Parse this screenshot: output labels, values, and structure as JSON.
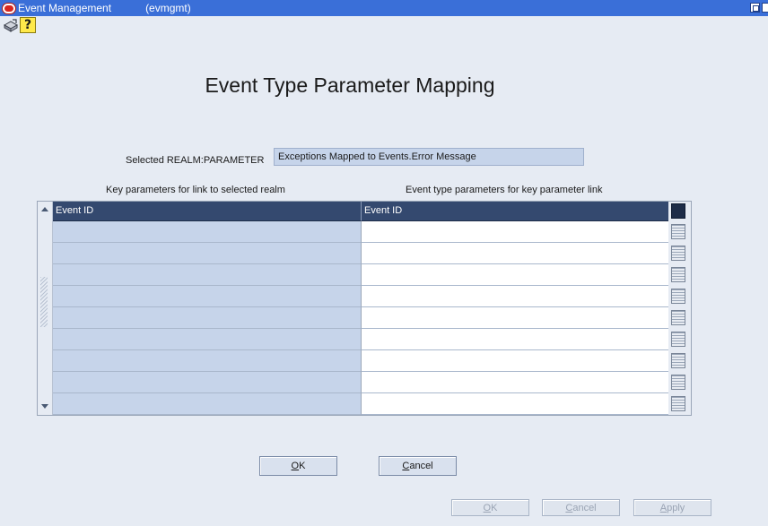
{
  "window": {
    "app_title": "Event Management",
    "module": "(evmgmt)"
  },
  "toolbar": {
    "action_icon": "action-icon",
    "help_label": "?"
  },
  "page": {
    "heading": "Event Type Parameter Mapping",
    "selected_label": "Selected REALM:PARAMETER",
    "selected_value": "Exceptions Mapped to Events.Error Message"
  },
  "table": {
    "left_caption": "Key parameters for link to selected realm",
    "right_caption": "Event type parameters for key parameter link",
    "columns": [
      "Event ID",
      "Event ID"
    ],
    "rows": [
      [
        "",
        ""
      ],
      [
        "",
        ""
      ],
      [
        "",
        ""
      ],
      [
        "",
        ""
      ],
      [
        "",
        ""
      ],
      [
        "",
        ""
      ],
      [
        "",
        ""
      ],
      [
        "",
        ""
      ],
      [
        "",
        ""
      ]
    ]
  },
  "buttons": {
    "ok_first": "O",
    "ok_rest": "K",
    "cancel_first": "C",
    "cancel_rest": "ancel"
  },
  "footer": {
    "ok_first": "O",
    "ok_rest": "K",
    "cancel_first": "C",
    "cancel_rest": "ancel",
    "apply_first": "A",
    "apply_rest": "pply"
  },
  "colors": {
    "titlebar": "#3a6fd8",
    "header": "#34496f",
    "field": "#c6d4ea",
    "background": "#e6ebf3"
  }
}
